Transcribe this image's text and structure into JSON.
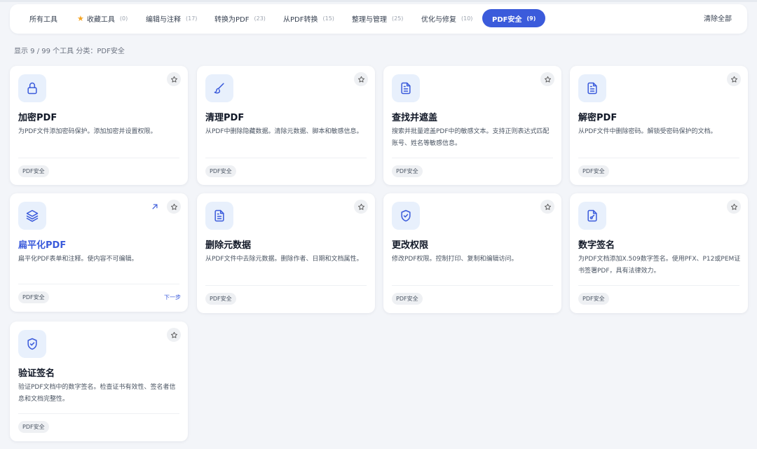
{
  "filters": [
    {
      "label": "所有工具",
      "count": ""
    },
    {
      "label": "收藏工具",
      "count": "(0)"
    },
    {
      "label": "编辑与注释",
      "count": "(17)"
    },
    {
      "label": "转换为PDF",
      "count": "(23)"
    },
    {
      "label": "从PDF转换",
      "count": "(15)"
    },
    {
      "label": "整理与管理",
      "count": "(25)"
    },
    {
      "label": "优化与修复",
      "count": "(10)"
    },
    {
      "label": "PDF安全",
      "count": "(9)"
    }
  ],
  "active_filter": "PDF安全",
  "clear_all_label": "清除全部",
  "summary": "显示 9 / 99 个工具 分类：PDF安全",
  "accent_color": "#3b5bdb",
  "tools": [
    {
      "title": "加密PDF",
      "desc": "为PDF文件添加密码保护。添加加密并设置权限。",
      "tag": "PDF安全",
      "icon": "lock-icon"
    },
    {
      "title": "清理PDF",
      "desc": "从PDF中删除隐藏数据。清除元数据、脚本和敏感信息。",
      "tag": "PDF安全",
      "icon": "brush-icon"
    },
    {
      "title": "查找并遮盖",
      "desc": "搜索并批量遮盖PDF中的敏感文本。支持正则表达式匹配账号、姓名等敏感信息。",
      "tag": "PDF安全",
      "icon": "document-icon"
    },
    {
      "title": "解密PDF",
      "desc": "从PDF文件中删除密码。解锁受密码保护的文档。",
      "tag": "PDF安全",
      "icon": "document-icon"
    },
    {
      "title": "扁平化PDF",
      "desc": "扁平化PDF表单和注释。使内容不可编辑。",
      "tag": "PDF安全",
      "icon": "layers-icon",
      "next_label": "下一步"
    },
    {
      "title": "删除元数据",
      "desc": "从PDF文件中去除元数据。删除作者、日期和文档属性。",
      "tag": "PDF安全",
      "icon": "document-icon"
    },
    {
      "title": "更改权限",
      "desc": "修改PDF权限。控制打印、复制和编辑访问。",
      "tag": "PDF安全",
      "icon": "shield-check-icon"
    },
    {
      "title": "数字签名",
      "desc": "为PDF文档添加X.509数字签名。使用PFX、P12或PEM证书签署PDF，具有法律效力。",
      "tag": "PDF安全",
      "icon": "signature-file-icon"
    },
    {
      "title": "验证签名",
      "desc": "验证PDF文档中的数字签名。检查证书有效性、签名者信息和文档完整性。",
      "tag": "PDF安全",
      "icon": "shield-check-icon"
    }
  ]
}
